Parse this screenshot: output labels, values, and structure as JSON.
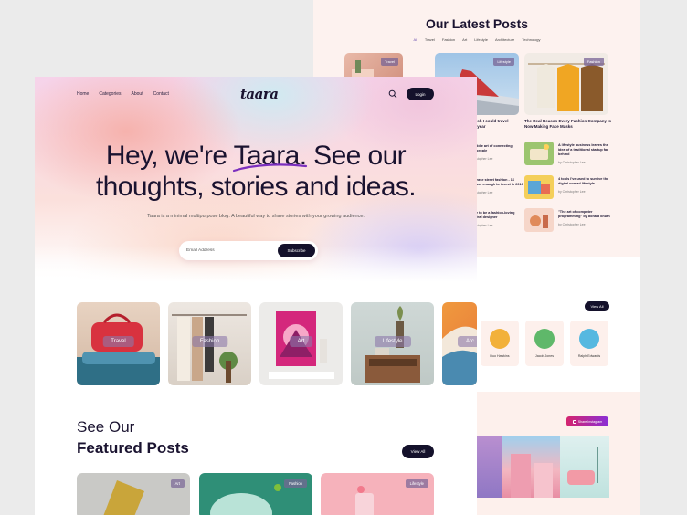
{
  "latest": {
    "title": "Our Latest Posts",
    "filters": [
      "All",
      "Travel",
      "Fashion",
      "Art",
      "Lifestyle",
      "Architecture",
      "Technology"
    ],
    "cards": [
      {
        "tag": "Travel"
      },
      {
        "tag": "Lifestyle"
      },
      {
        "tag": "Fashion"
      }
    ],
    "card_titles": [
      "ish I could travel\n year",
      "The Real Reason Every Fashion Company Is\nNow Making Face Masks"
    ],
    "list_left": [
      {
        "title": "ddle art of connecting\npeople",
        "meta": "stopher Lee"
      },
      {
        "title": "ease street fashion - 16\nave enough to invest in 2016",
        "meta": "stopher Lee"
      },
      {
        "title": "e to be a fashion-loving\nfeal designer",
        "meta": "stopher Lee"
      }
    ],
    "list_right": [
      {
        "title": "A lifestyle business leaves the\nidea of a traditional startup far\nbehind",
        "meta": "by Christopher Lee"
      },
      {
        "title": "4 tools I've used to survive the\ndigital nomad lifestyle",
        "meta": "by Christopher Lee"
      },
      {
        "title": "\"The art of computer\nprogramming\" by donald knuth",
        "meta": "by Christopher Lee"
      }
    ]
  },
  "authors": {
    "view_all": "View All",
    "people": [
      {
        "name": "Duo Hawkins"
      },
      {
        "name": "Jacob Jones"
      },
      {
        "name": "Ralph Edwards"
      }
    ]
  },
  "instagram": {
    "button": "Share Instagram"
  },
  "nav": {
    "items": [
      "Home",
      "Categories",
      "About",
      "Contact"
    ],
    "logo": "taara",
    "login": "Login"
  },
  "hero": {
    "headline_line1": "Hey, we're Taara. See our",
    "headline_line2": "thoughts, stories and ideas.",
    "subtitle": "Taara is a minimal multipurpose blog. A beautiful way to share stories with your growing audience.",
    "email_placeholder": "Email Address",
    "subscribe": "Subscribe"
  },
  "categories": [
    "Travel",
    "Fashion",
    "Art",
    "Lifestyle",
    "Arc"
  ],
  "featured": {
    "line1": "See Our",
    "line2": "Featured Posts",
    "view_all": "View All",
    "posts": [
      {
        "tag": "Art"
      },
      {
        "tag": "Fashion"
      },
      {
        "tag": "Lifestyle"
      }
    ]
  },
  "colors": {
    "dark": "#14112b",
    "accent_underline": "#7b2fbe",
    "peach": "#fdf2ef"
  }
}
